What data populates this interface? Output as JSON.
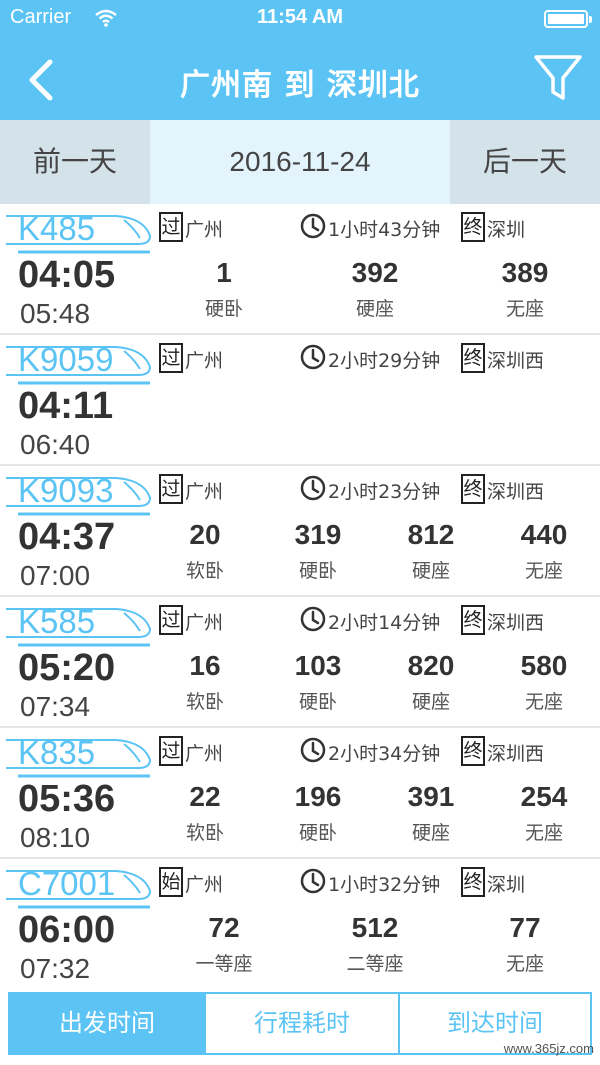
{
  "status_bar": {
    "carrier": "Carrier",
    "time": "11:54 AM",
    "wifi_icon": "wifi-icon",
    "battery_icon": "battery-icon"
  },
  "nav": {
    "title": "广州南 到 深圳北",
    "back_icon": "chevron-left-icon",
    "filter_icon": "filter-icon"
  },
  "date_bar": {
    "prev_label": "前一天",
    "date": "2016-11-24",
    "next_label": "后一天"
  },
  "trains": [
    {
      "no": "K485",
      "depart": "04:05",
      "arrive": "05:48",
      "from_tag": "过",
      "from": "广州",
      "duration": "1小时43分钟",
      "to_tag": "终",
      "to": "深圳",
      "seats": [
        {
          "count": "1",
          "type": "硬卧"
        },
        {
          "count": "392",
          "type": "硬座"
        },
        {
          "count": "389",
          "type": "无座"
        }
      ]
    },
    {
      "no": "K9059",
      "depart": "04:11",
      "arrive": "06:40",
      "from_tag": "过",
      "from": "广州",
      "duration": "2小时29分钟",
      "to_tag": "终",
      "to": "深圳西",
      "seats": []
    },
    {
      "no": "K9093",
      "depart": "04:37",
      "arrive": "07:00",
      "from_tag": "过",
      "from": "广州",
      "duration": "2小时23分钟",
      "to_tag": "终",
      "to": "深圳西",
      "seats": [
        {
          "count": "20",
          "type": "软卧"
        },
        {
          "count": "319",
          "type": "硬卧"
        },
        {
          "count": "812",
          "type": "硬座"
        },
        {
          "count": "440",
          "type": "无座"
        }
      ]
    },
    {
      "no": "K585",
      "depart": "05:20",
      "arrive": "07:34",
      "from_tag": "过",
      "from": "广州",
      "duration": "2小时14分钟",
      "to_tag": "终",
      "to": "深圳西",
      "seats": [
        {
          "count": "16",
          "type": "软卧"
        },
        {
          "count": "103",
          "type": "硬卧"
        },
        {
          "count": "820",
          "type": "硬座"
        },
        {
          "count": "580",
          "type": "无座"
        }
      ]
    },
    {
      "no": "K835",
      "depart": "05:36",
      "arrive": "08:10",
      "from_tag": "过",
      "from": "广州",
      "duration": "2小时34分钟",
      "to_tag": "终",
      "to": "深圳西",
      "seats": [
        {
          "count": "22",
          "type": "软卧"
        },
        {
          "count": "196",
          "type": "硬卧"
        },
        {
          "count": "391",
          "type": "硬座"
        },
        {
          "count": "254",
          "type": "无座"
        }
      ]
    },
    {
      "no": "C7001",
      "depart": "06:00",
      "arrive": "07:32",
      "from_tag": "始",
      "from": "广州",
      "duration": "1小时32分钟",
      "to_tag": "终",
      "to": "深圳",
      "seats": [
        {
          "count": "72",
          "type": "一等座"
        },
        {
          "count": "512",
          "type": "二等座"
        },
        {
          "count": "77",
          "type": "无座"
        }
      ]
    }
  ],
  "tabs": [
    {
      "label": "出发时间",
      "active": true
    },
    {
      "label": "行程耗时",
      "active": false
    },
    {
      "label": "到达时间",
      "active": false
    }
  ],
  "watermark": "www.365jz.com",
  "colors": {
    "accent": "#5bc4f5",
    "date_bg": "#e3f4fd",
    "side_btn_bg": "#d4e2ea"
  }
}
